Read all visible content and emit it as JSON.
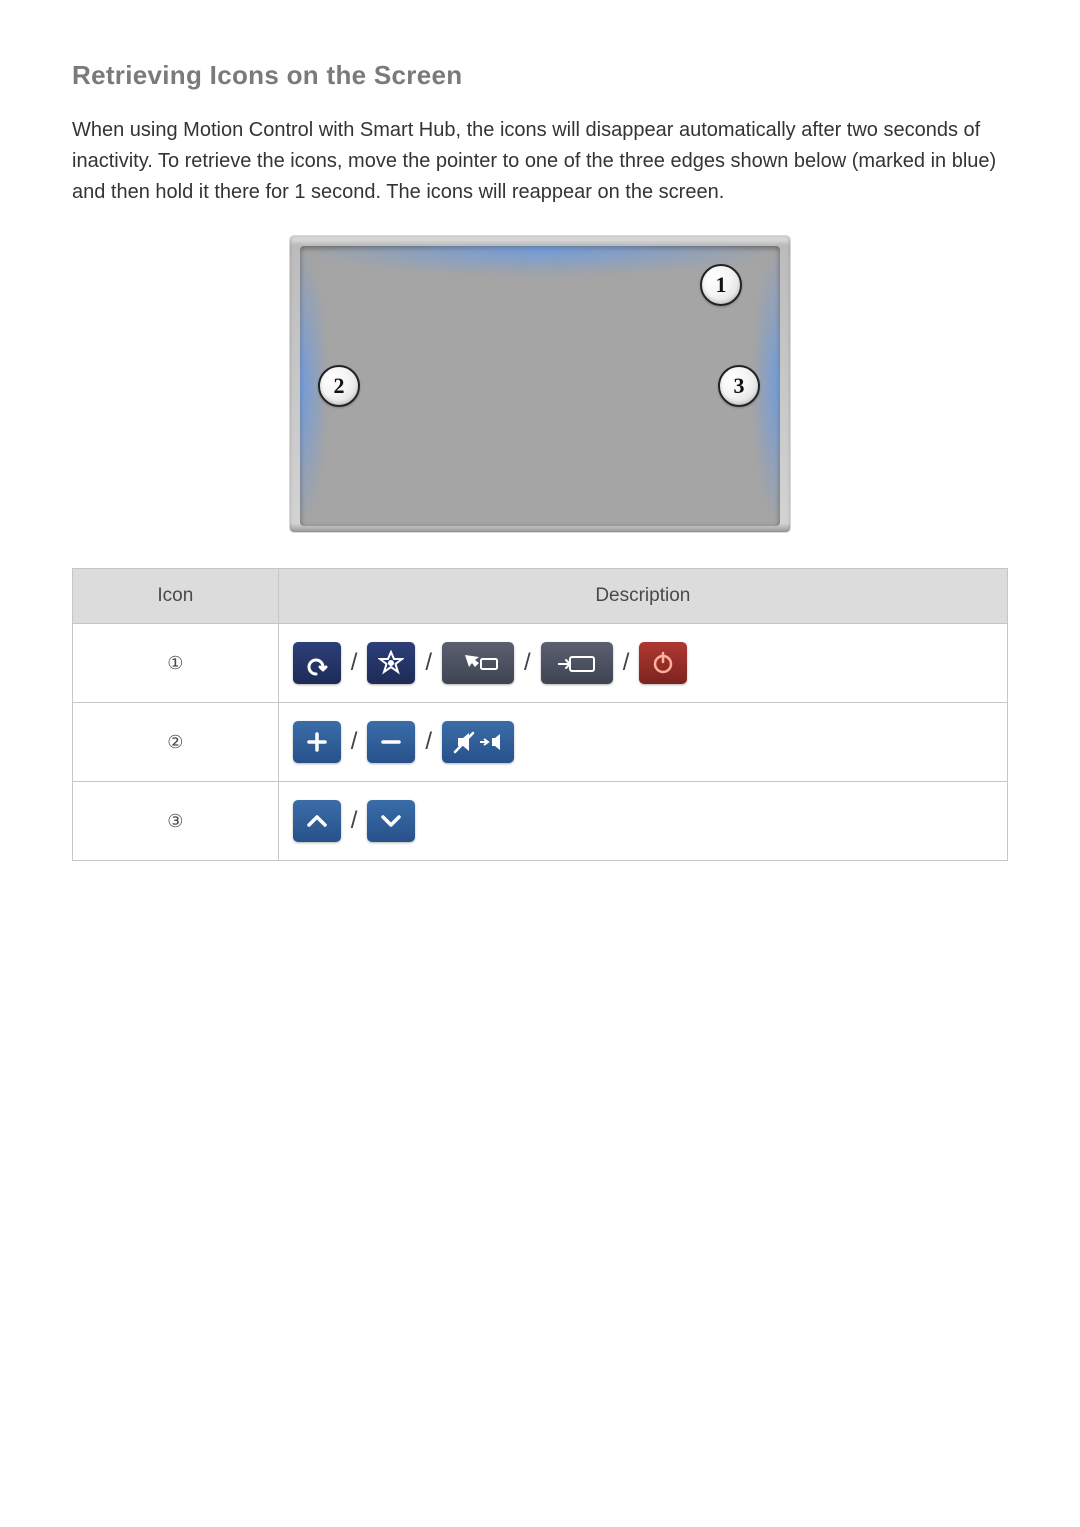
{
  "heading": "Retrieving Icons on the Screen",
  "paragraph": "When using Motion Control with Smart Hub, the icons will disappear automatically after two seconds of inactivity. To retrieve the icons, move the pointer to one of the three edges shown below (marked in blue) and then hold it there for 1 second. The icons will reappear on the screen.",
  "diagram_callouts": {
    "one": "1",
    "two": "2",
    "three": "3"
  },
  "table": {
    "headers": {
      "icon": "Icon",
      "description": "Description"
    },
    "rows": [
      {
        "label": "①",
        "icons": [
          {
            "name": "return-icon",
            "palette": "navy",
            "wide": false
          },
          {
            "name": "smarthub-icon",
            "palette": "navy",
            "wide": false
          },
          {
            "name": "pointer-icon",
            "palette": "gray",
            "wide": true
          },
          {
            "name": "source-icon",
            "palette": "gray",
            "wide": true
          },
          {
            "name": "power-icon",
            "palette": "red",
            "wide": false
          }
        ]
      },
      {
        "label": "②",
        "icons": [
          {
            "name": "volume-up-icon",
            "palette": "blue",
            "wide": false
          },
          {
            "name": "volume-down-icon",
            "palette": "blue",
            "wide": false
          },
          {
            "name": "mute-icon",
            "palette": "blue",
            "wide": true
          }
        ]
      },
      {
        "label": "③",
        "icons": [
          {
            "name": "channel-up-icon",
            "palette": "blue",
            "wide": false
          },
          {
            "name": "channel-down-icon",
            "palette": "blue",
            "wide": false
          }
        ]
      }
    ]
  },
  "separator": "/"
}
